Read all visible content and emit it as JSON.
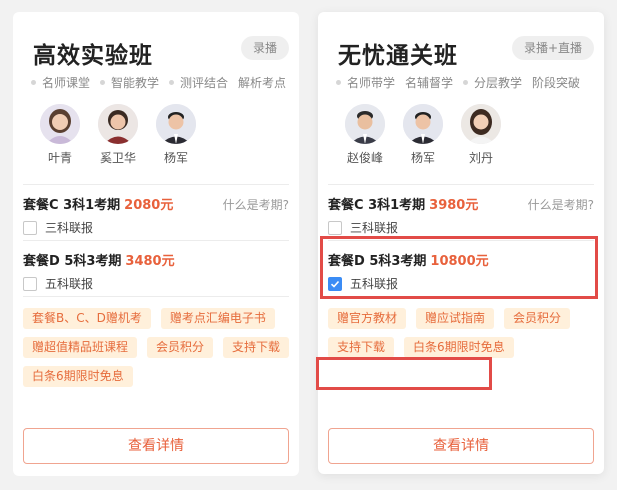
{
  "colors": {
    "price": "#e8613c",
    "tag_bg": "#fff0db",
    "tag_text": "#e66c3c",
    "highlight": "#e24b47",
    "checkbox_checked": "#3b8cf5"
  },
  "cards": [
    {
      "title": "高效实验班",
      "mode_badge": "录播",
      "features": [
        "名师课堂",
        "智能教学",
        "测评结合",
        "解析考点"
      ],
      "teachers": [
        {
          "name": "叶青",
          "avatar": "female-teacher-avatar"
        },
        {
          "name": "奚卫华",
          "avatar": "female-teacher-avatar"
        },
        {
          "name": "杨军",
          "avatar": "male-teacher-avatar"
        }
      ],
      "packages": [
        {
          "title": "套餐C 3科1考期",
          "price": "2080元",
          "help": "什么是考期?",
          "option": "三科联报",
          "checked": false
        },
        {
          "title": "套餐D 5科3考期",
          "price": "3480元",
          "option": "五科联报",
          "checked": false
        }
      ],
      "tags": [
        "套餐B、C、D赠机考",
        "赠考点汇编电子书",
        "赠超值精品班课程",
        "会员积分",
        "支持下载",
        "白条6期限时免息"
      ],
      "detail_button": "查看详情"
    },
    {
      "title": "无忧通关班",
      "mode_badge": "录播+直播",
      "features": [
        "名师带学",
        "名辅督学",
        "分层教学",
        "阶段突破"
      ],
      "teachers": [
        {
          "name": "赵俊峰",
          "avatar": "male-teacher-avatar"
        },
        {
          "name": "杨军",
          "avatar": "male-teacher-avatar"
        },
        {
          "name": "刘丹",
          "avatar": "female-teacher-avatar"
        }
      ],
      "packages": [
        {
          "title": "套餐C 3科1考期",
          "price": "3980元",
          "help": "什么是考期?",
          "option": "三科联报",
          "checked": false
        },
        {
          "title": "套餐D 5科3考期",
          "price": "10800元",
          "option": "五科联报",
          "checked": true
        }
      ],
      "tags": [
        "赠官方教材",
        "赠应试指南",
        "会员积分",
        "支持下载",
        "白条6期限时免息"
      ],
      "detail_button": "查看详情"
    }
  ]
}
